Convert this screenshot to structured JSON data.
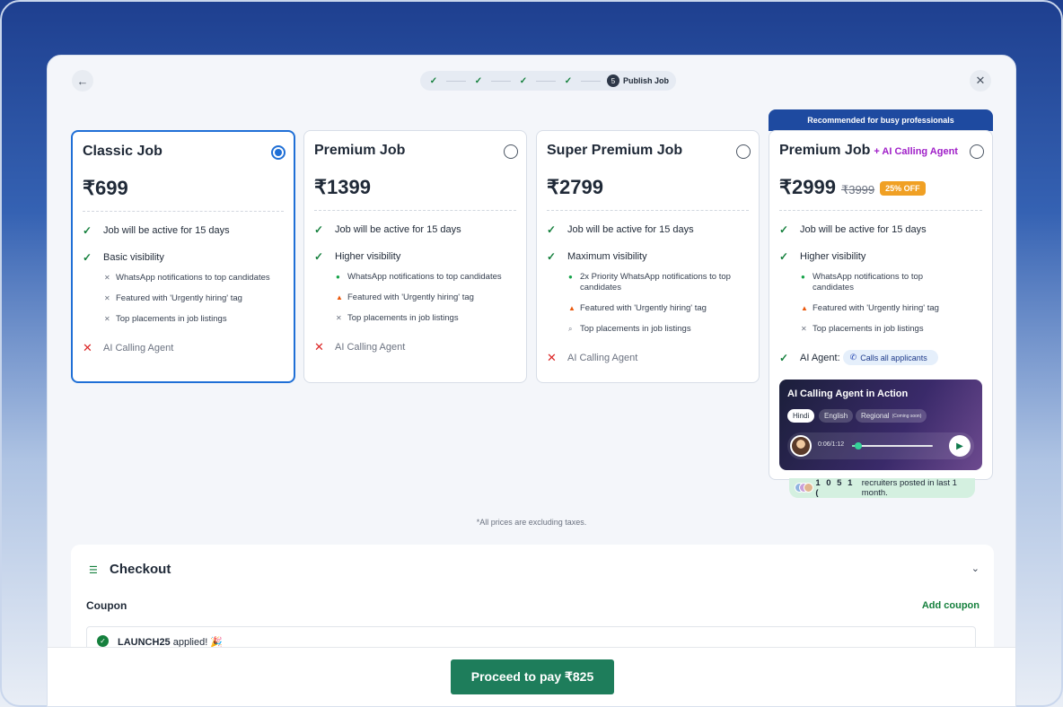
{
  "stepper": {
    "step_number": "5",
    "step_label": "Publish Job"
  },
  "plans": [
    {
      "title": "Classic Job",
      "price": "₹699",
      "features": {
        "active": "Job will be active for 15 days",
        "visibility": "Basic visibility",
        "sub": [
          "WhatsApp notifications to top candidates",
          "Featured with 'Urgently hiring' tag",
          "Top placements in job listings"
        ],
        "ai": "AI Calling Agent"
      }
    },
    {
      "title": "Premium Job",
      "price": "₹1399",
      "features": {
        "active": "Job will be active for 15 days",
        "visibility": "Higher visibility",
        "sub": [
          "WhatsApp notifications to top candidates",
          "Featured with 'Urgently hiring' tag",
          "Top placements in job listings"
        ],
        "ai": "AI Calling Agent"
      }
    },
    {
      "title": "Super Premium Job",
      "price": "₹2799",
      "features": {
        "active": "Job will be active for 15 days",
        "visibility": "Maximum visibility",
        "sub": [
          "2x Priority WhatsApp notifications to top candidates",
          "Featured with 'Urgently hiring' tag",
          "Top placements in job listings"
        ],
        "ai": "AI Calling Agent"
      }
    },
    {
      "banner": "Recommended for busy professionals",
      "title": "Premium Job",
      "title_tag": "+ AI Calling Agent",
      "price": "₹2999",
      "old_price": "₹3999",
      "discount": "25% OFF",
      "features": {
        "active": "Job will be active for 15 days",
        "visibility": "Higher visibility",
        "sub": [
          "WhatsApp notifications to top candidates",
          "Featured with 'Urgently hiring' tag",
          "Top placements in job listings"
        ],
        "ai_label": "AI Agent:",
        "ai_pill": "Calls all applicants"
      },
      "demo": {
        "title": "AI Calling Agent in Action",
        "languages": [
          "Hindi",
          "English",
          "Regional"
        ],
        "coming_soon": "(Coming soon)",
        "time": "0:06/1:12",
        "progress": 0.08
      },
      "social": {
        "count": "1 0 5 1 (",
        "text": "recruiters posted in last 1 month."
      }
    }
  ],
  "tax_note": "*All prices are excluding taxes.",
  "checkout": {
    "title": "Checkout",
    "coupon_label": "Coupon",
    "add_coupon": "Add coupon",
    "coupon_code": "LAUNCH25",
    "coupon_status": "applied!",
    "coupon_emoji": "🎉"
  },
  "pay_button": "Proceed to pay ₹825",
  "colors": {
    "primary_green": "#1e7d5b",
    "selected_blue": "#1f6fd6",
    "banner_blue": "#1e4aa0",
    "ai_purple": "#a020c8"
  }
}
